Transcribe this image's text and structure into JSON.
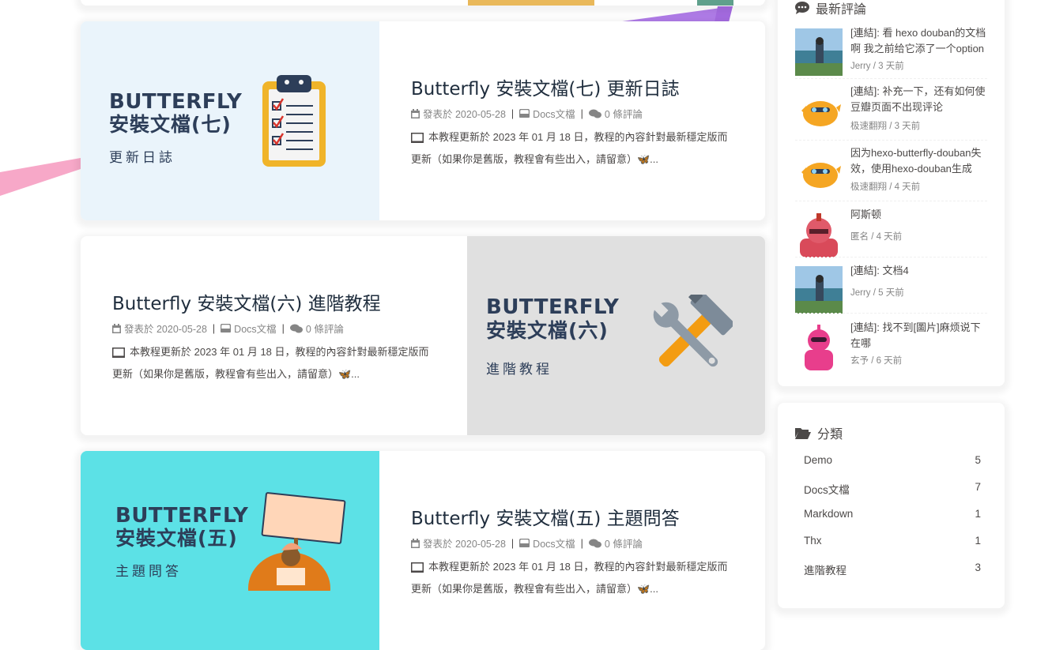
{
  "posts": [
    {
      "title": "Butterfly 安裝文檔(七) 更新日誌",
      "date_label": "發表於 2020-05-28",
      "category": "Docs文檔",
      "comments": "0 條評論",
      "excerpt": "本教程更新於 2023 年 01 月 18 日，教程的內容針對最新穩定版而更新（如果你是舊版，教程會有些出入，請留意）🦋...",
      "cover_line1": "BUTTERFLY",
      "cover_line2": "安裝文檔(七)",
      "cover_sub": "更新日誌",
      "cover_bg": "#eaf4fb"
    },
    {
      "title": "Butterfly 安裝文檔(六) 進階教程",
      "date_label": "發表於 2020-05-28",
      "category": "Docs文檔",
      "comments": "0 條評論",
      "excerpt": "本教程更新於 2023 年 01 月 18 日，教程的內容針對最新穩定版而更新（如果你是舊版，教程會有些出入，請留意）🦋...",
      "cover_line1": "BUTTERFLY",
      "cover_line2": "安裝文檔(六)",
      "cover_sub": "進階教程",
      "cover_bg": "#e0e0e0"
    },
    {
      "title": "Butterfly 安裝文檔(五) 主題問答",
      "date_label": "發表於 2020-05-28",
      "category": "Docs文檔",
      "comments": "0 條評論",
      "excerpt": "本教程更新於 2023 年 01 月 18 日，教程的內容針對最新穩定版而更新（如果你是舊版，教程會有些出入，請留意）🦋...",
      "cover_line1": "BUTTERFLY",
      "cover_line2": "安裝文檔(五)",
      "cover_sub": "主題問答",
      "cover_bg": "#5ce1e6"
    }
  ],
  "recent_comments": {
    "title": "最新評論",
    "items": [
      {
        "text": "[連結]: 看 hexo douban的文档啊 我之前给它添了一个option",
        "who": "Jerry / 3 天前"
      },
      {
        "text": "[連結]: 补充一下，还有如何使豆瓣页面不出现评论",
        "who": "极速翻翔 / 3 天前"
      },
      {
        "text": "因为hexo-butterfly-douban失效，使用hexo-douban生成",
        "who": "极速翻翔 / 4 天前"
      },
      {
        "text": "阿斯顿",
        "who": "匿名 / 4 天前"
      },
      {
        "text": "[連結]: 文档4",
        "who": "Jerry / 5 天前"
      },
      {
        "text": "[連結]: 找不到[圖片]麻烦说下在哪",
        "who": "玄予 / 6 天前"
      }
    ]
  },
  "categories": {
    "title": "分類",
    "items": [
      {
        "name": "Demo",
        "count": "5"
      },
      {
        "name": "Docs文檔",
        "count": "7"
      },
      {
        "name": "Markdown",
        "count": "1"
      },
      {
        "name": "Thx",
        "count": "1"
      },
      {
        "name": "進階教程",
        "count": "3"
      }
    ]
  },
  "colors": {
    "title": "#1f2d3d",
    "text": "#4c4948",
    "meta": "#858585",
    "cover_text": "#2d3e59",
    "ribbon_pink": "#f6a5c6",
    "ribbon_purple": "#a877e8"
  }
}
